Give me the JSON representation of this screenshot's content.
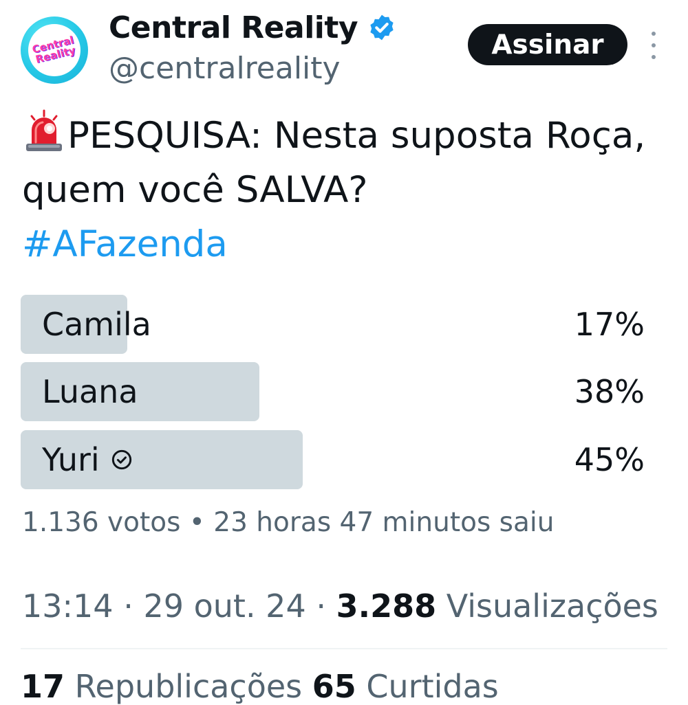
{
  "account": {
    "avatar_text": "Central\nReality",
    "display_name": "Central Reality",
    "handle": "@centralreality",
    "subscribe_label": "Assinar"
  },
  "icons": {
    "verified": "verified-badge-icon",
    "siren": "rotating-light-icon",
    "more": "more-vertical-icon",
    "winner": "check-circle-icon"
  },
  "tweet": {
    "line1": "PESQUISA: Nesta suposta Roça, quem você SALVA?",
    "hashtag": "#AFazenda"
  },
  "poll": {
    "options": [
      {
        "label": "Camila",
        "percent": "17%",
        "value": 17
      },
      {
        "label": "Luana",
        "percent": "38%",
        "value": 38
      },
      {
        "label": "Yuri",
        "percent": "45%",
        "value": 45,
        "winner": true
      }
    ],
    "votes": "1.136 votos",
    "separator": " • ",
    "time_left": "23 horas 47 minutos saiu"
  },
  "meta": {
    "time": "13:14",
    "dot": " · ",
    "date": "29 out. 24",
    "views_count": "3.288",
    "views_label": "Visualizações"
  },
  "stats": {
    "reposts_count": "17",
    "reposts_label": "Republicações",
    "likes_count": "65",
    "likes_label": "Curtidas"
  },
  "colors": {
    "brand_blue": "#1d9bf0",
    "poll_bar": "#cfd9de",
    "muted_text": "#536471",
    "primary_text": "#0f1419"
  }
}
